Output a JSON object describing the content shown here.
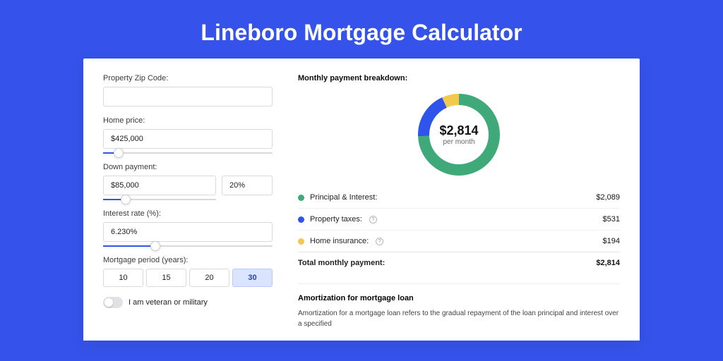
{
  "title": "Lineboro Mortgage Calculator",
  "form": {
    "zip_label": "Property Zip Code:",
    "zip_value": "",
    "price_label": "Home price:",
    "price_value": "$425,000",
    "price_slider_pct": 9,
    "down_label": "Down payment:",
    "down_value": "$85,000",
    "down_pct_value": "20%",
    "down_slider_pct": 20,
    "rate_label": "Interest rate (%):",
    "rate_value": "6.230%",
    "rate_slider_pct": 31,
    "period_label": "Mortgage period (years):",
    "periods": [
      "10",
      "15",
      "20",
      "30"
    ],
    "period_selected": "30",
    "veteran_label": "I am veteran or military",
    "veteran_on": false
  },
  "breakdown": {
    "title": "Monthly payment breakdown:",
    "total_amount": "$2,814",
    "total_sub": "per month",
    "items": [
      {
        "label": "Principal & Interest:",
        "value": "$2,089",
        "color": "#3fa97a",
        "info": false
      },
      {
        "label": "Property taxes:",
        "value": "$531",
        "color": "#2f54eb",
        "info": true
      },
      {
        "label": "Home insurance:",
        "value": "$194",
        "color": "#f2c94c",
        "info": true
      }
    ],
    "total_label": "Total monthly payment:",
    "total_value": "$2,814"
  },
  "amortization": {
    "title": "Amortization for mortgage loan",
    "text": "Amortization for a mortgage loan refers to the gradual repayment of the loan principal and interest over a specified"
  },
  "chart_data": {
    "type": "pie",
    "title": "Monthly payment breakdown",
    "series": [
      {
        "name": "Principal & Interest",
        "value": 2089,
        "color": "#3fa97a"
      },
      {
        "name": "Property taxes",
        "value": 531,
        "color": "#2f54eb"
      },
      {
        "name": "Home insurance",
        "value": 194,
        "color": "#f2c94c"
      }
    ],
    "center_label": "$2,814 per month",
    "donut": true
  }
}
